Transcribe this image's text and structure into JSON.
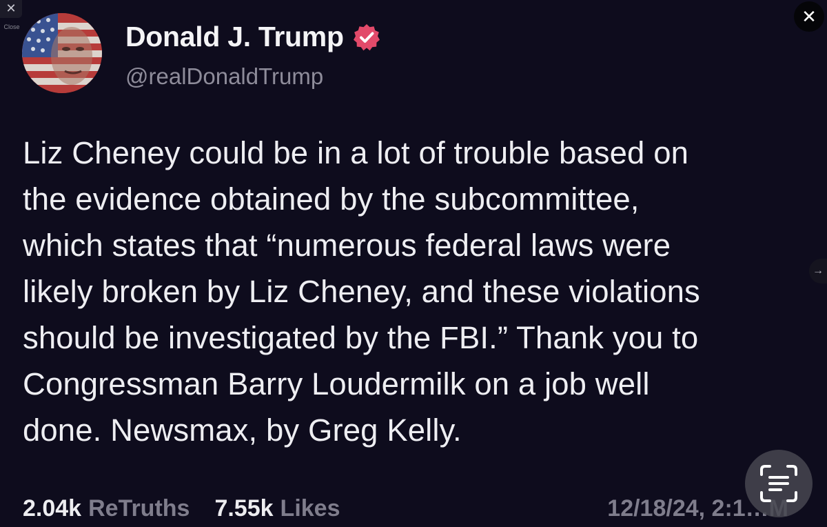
{
  "viewer": {
    "close_label": "Close",
    "close_glyph": "✕",
    "close_button_glyph": "✕",
    "next_glyph": "→"
  },
  "post": {
    "display_name": "Donald J. Trump",
    "handle": "@realDonaldTrump",
    "verified": true,
    "verified_color": "#e24a6a",
    "body": "Liz Cheney could be in a lot of trouble based on the evidence obtained by the subcommittee, which states that “numerous federal laws were likely broken by Liz Cheney, and these violations should be investigated by the FBI.” Thank you to Congressman Barry Loudermilk on a job well done. Newsmax, by Greg Kelly.",
    "body_lines": [
      "Liz Cheney could be in a lot of trouble based on",
      "the evidence obtained by the subcommittee,",
      "which states that “numerous federal laws were",
      "likely broken by Liz Cheney, and these violations",
      "should be investigated by the FBI.” Thank you to",
      "Congressman Barry Loudermilk on a job well",
      "done. Newsmax, by Greg Kelly."
    ],
    "retruths_count": "2.04k",
    "retruths_label": "ReTruths",
    "likes_count": "7.55k",
    "likes_label": "Likes",
    "timestamp": "12/18/24, 2:1…M"
  },
  "icons": {
    "avatar": "flag-portrait-avatar",
    "verified": "verified-badge-icon",
    "live_text": "live-text-scan-icon"
  }
}
